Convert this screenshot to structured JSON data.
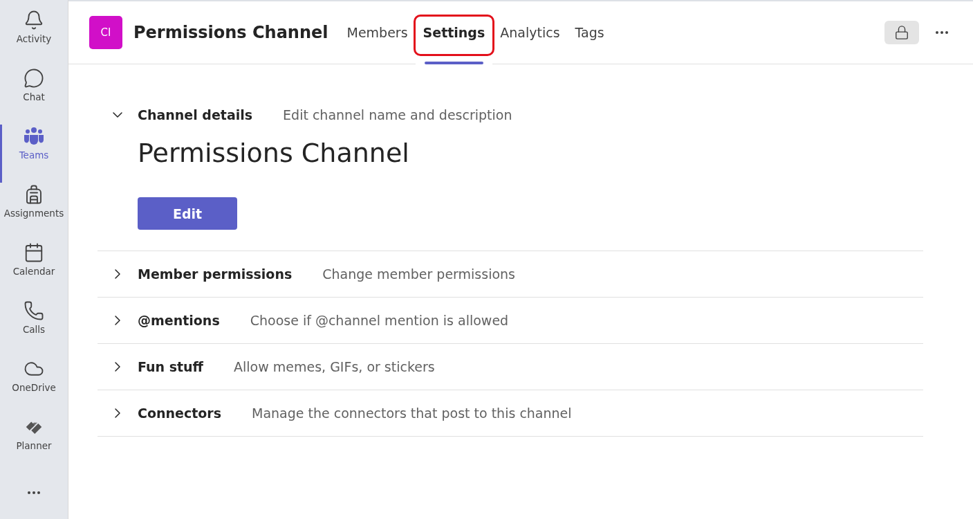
{
  "sidebar": {
    "items": [
      {
        "kind": "bell",
        "label": "Activity",
        "selected": false
      },
      {
        "kind": "chat",
        "label": "Chat",
        "selected": false
      },
      {
        "kind": "teams",
        "label": "Teams",
        "selected": true
      },
      {
        "kind": "backpack",
        "label": "Assignments",
        "selected": false
      },
      {
        "kind": "calendar",
        "label": "Calendar",
        "selected": false
      },
      {
        "kind": "phone",
        "label": "Calls",
        "selected": false
      },
      {
        "kind": "cloud",
        "label": "OneDrive",
        "selected": false
      },
      {
        "kind": "planner",
        "label": "Planner",
        "selected": false
      }
    ]
  },
  "header": {
    "avatar": "CI",
    "title": "Permissions Channel",
    "tabs": [
      {
        "label": "Members",
        "selected": false,
        "annotated": false
      },
      {
        "label": "Settings",
        "selected": true,
        "annotated": true
      },
      {
        "label": "Analytics",
        "selected": false,
        "annotated": false
      },
      {
        "label": "Tags",
        "selected": false,
        "annotated": false
      }
    ]
  },
  "sections": [
    {
      "title": "Channel details",
      "description": "Edit channel name and description",
      "expanded": true,
      "channel_name": "Permissions Channel",
      "button": "Edit"
    },
    {
      "title": "Member permissions",
      "description": "Change member permissions",
      "expanded": false
    },
    {
      "title": "@mentions",
      "description": "Choose if @channel mention is allowed",
      "expanded": false
    },
    {
      "title": "Fun stuff",
      "description": "Allow memes, GIFs, or stickers",
      "expanded": false
    },
    {
      "title": "Connectors",
      "description": "Manage the connectors that post to this channel",
      "expanded": false
    }
  ]
}
